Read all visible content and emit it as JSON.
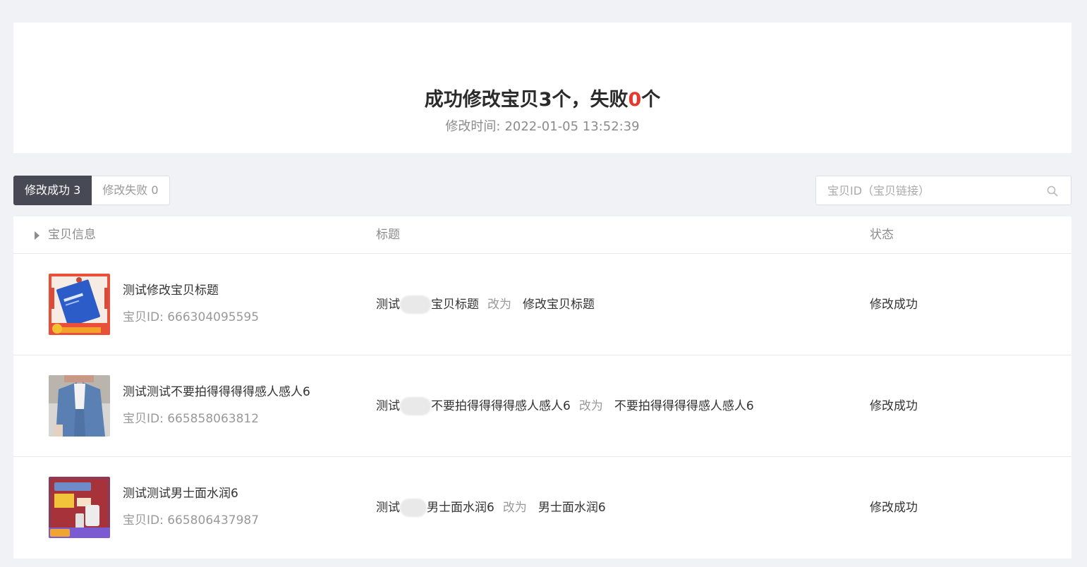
{
  "summary": {
    "title_prefix": "成功修改宝贝",
    "success_count": "3",
    "title_middle": "个，失败",
    "fail_count": "0",
    "title_suffix": "个",
    "time_label": "修改时间:",
    "time_value": "2022-01-05 13:52:39"
  },
  "tabs": {
    "success": "修改成功 3",
    "failed": "修改失败 0"
  },
  "search": {
    "placeholder": "宝贝ID（宝贝链接）"
  },
  "table": {
    "headers": {
      "info": "宝贝信息",
      "title": "标题",
      "status": "状态"
    },
    "rows": [
      {
        "name": "测试修改宝贝标题",
        "id_text": "宝贝ID: 666304095595",
        "old_prefix": "测试",
        "old_suffix": "宝贝标题",
        "change_word": "改为",
        "new_title": "修改宝贝标题",
        "status": "修改成功"
      },
      {
        "name": "测试测试不要拍得得得得感人感人6",
        "id_text": "宝贝ID: 665858063812",
        "old_prefix": "测试",
        "old_suffix": "不要拍得得得得感人感人6",
        "change_word": "改为",
        "new_title": "不要拍得得得得感人感人6",
        "status": "修改成功"
      },
      {
        "name": "测试测试男士面水润6",
        "id_text": "宝贝ID: 665806437987",
        "old_prefix": "测试",
        "old_suffix": "男士面水润6",
        "change_word": "改为",
        "new_title": "男士面水润6",
        "status": "修改成功"
      }
    ]
  },
  "colors": {
    "fail_count": "#e8382e",
    "tab_active_bg": "#474a54",
    "page_bg": "#f0f2f5"
  }
}
